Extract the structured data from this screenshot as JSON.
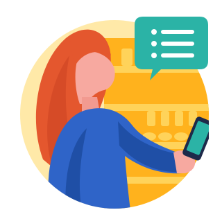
{
  "illustration": {
    "subject": "woman-using-phone-in-store",
    "icons": [
      "chat-list-icon",
      "smartphone-icon"
    ]
  },
  "colors": {
    "background_circle": "#FFE9A8",
    "shelf_orange": "#FFB21D",
    "shelf_light": "#FFD35A",
    "hair": "#E4572E",
    "hair_dark": "#C8401F",
    "skin": "#F7A9A0",
    "sweater": "#2F64C8",
    "sweater_dark": "#1F4FA6",
    "chat_bubble": "#2BB3A6",
    "chat_lines": "#FFFFFF",
    "phone": "#1E2A4A",
    "phone_screen": "#2BB3A6"
  }
}
